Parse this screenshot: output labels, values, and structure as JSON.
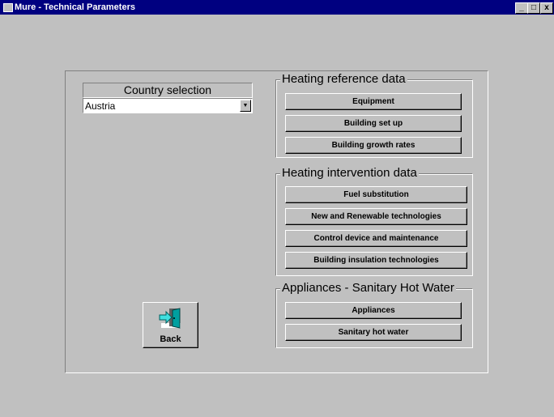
{
  "window": {
    "title": "Mure - Technical Parameters",
    "controls": [
      "_",
      "□",
      "x"
    ]
  },
  "colors": {
    "titlebar": "#000080",
    "face": "#c0c0c0"
  },
  "country": {
    "label": "Country selection",
    "selected": "Austria"
  },
  "groups": [
    {
      "title": "Heating reference data",
      "buttons": [
        "Equipment",
        "Building set up",
        "Building growth rates"
      ]
    },
    {
      "title": "Heating intervention data",
      "buttons": [
        "Fuel substitution",
        "New and Renewable technologies",
        "Control device and maintenance",
        "Building insulation technologies"
      ]
    },
    {
      "title": "Appliances - Sanitary Hot Water",
      "buttons": [
        "Appliances",
        "Sanitary hot water"
      ]
    }
  ],
  "back": {
    "label": "Back",
    "icon": "exit-door-icon"
  }
}
